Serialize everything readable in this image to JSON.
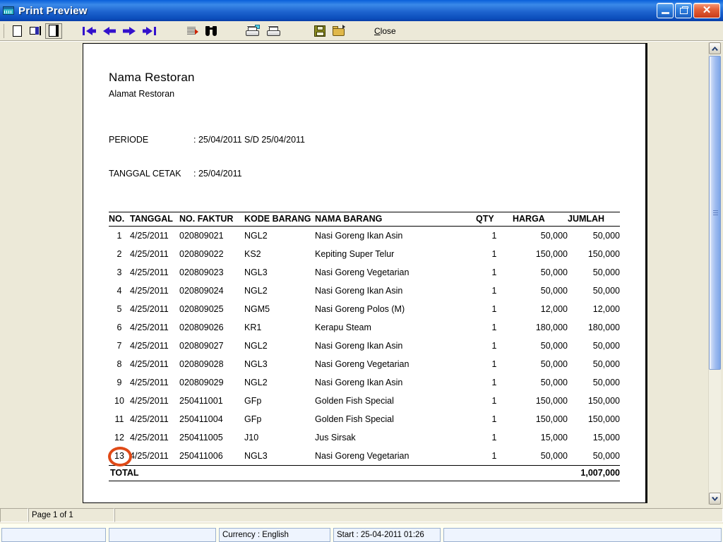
{
  "window": {
    "title": "Print Preview",
    "app_icon": "window-grid-icon",
    "controls": {
      "minimize": "minimize-button",
      "maximize": "maximize-restore-button",
      "close": "close-button",
      "close_glyph": "✕"
    }
  },
  "toolbar": {
    "buttons": [
      {
        "name": "single-page-view",
        "icon": "single-page-icon"
      },
      {
        "name": "two-page-view",
        "icon": "two-page-icon"
      },
      {
        "name": "page-width-view",
        "icon": "page-width-icon",
        "pressed": true
      },
      {
        "name": "first-page",
        "icon": "first-page-arrow-icon"
      },
      {
        "name": "previous-page",
        "icon": "previous-page-arrow-icon"
      },
      {
        "name": "next-page",
        "icon": "next-page-arrow-icon"
      },
      {
        "name": "last-page",
        "icon": "last-page-arrow-icon"
      },
      {
        "name": "goto-page",
        "icon": "lines-with-arrow-icon"
      },
      {
        "name": "find",
        "icon": "binoculars-icon"
      },
      {
        "name": "print-setup",
        "icon": "printer-setup-icon"
      },
      {
        "name": "print",
        "icon": "printer-icon"
      },
      {
        "name": "save",
        "icon": "floppy-disk-icon"
      },
      {
        "name": "open",
        "icon": "open-folder-icon"
      }
    ],
    "close_label_accel": "C",
    "close_label_rest": "lose",
    "close_label": "Close"
  },
  "document": {
    "title": "Nama Restoran",
    "subtitle": "Alamat Restoran",
    "meta": [
      {
        "label": "PERIODE",
        "value": ": 25/04/2011 S/D 25/04/2011"
      },
      {
        "label": "TANGGAL CETAK",
        "value": ": 25/04/2011"
      }
    ],
    "table": {
      "headers": [
        "NO.",
        "TANGGAL",
        "NO. FAKTUR",
        "KODE BARANG",
        "NAMA BARANG",
        "QTY",
        "HARGA",
        "JUMLAH"
      ],
      "rows": [
        [
          "1",
          "4/25/2011",
          "020809021",
          "NGL2",
          "Nasi Goreng Ikan Asin",
          "1",
          "50,000",
          "50,000"
        ],
        [
          "2",
          "4/25/2011",
          "020809022",
          "KS2",
          "Kepiting Super Telur",
          "1",
          "150,000",
          "150,000"
        ],
        [
          "3",
          "4/25/2011",
          "020809023",
          "NGL3",
          "Nasi Goreng Vegetarian",
          "1",
          "50,000",
          "50,000"
        ],
        [
          "4",
          "4/25/2011",
          "020809024",
          "NGL2",
          "Nasi Goreng Ikan Asin",
          "1",
          "50,000",
          "50,000"
        ],
        [
          "5",
          "4/25/2011",
          "020809025",
          "NGM5",
          "Nasi Goreng Polos (M)",
          "1",
          "12,000",
          "12,000"
        ],
        [
          "6",
          "4/25/2011",
          "020809026",
          "KR1",
          "Kerapu Steam",
          "1",
          "180,000",
          "180,000"
        ],
        [
          "7",
          "4/25/2011",
          "020809027",
          "NGL2",
          "Nasi Goreng Ikan Asin",
          "1",
          "50,000",
          "50,000"
        ],
        [
          "8",
          "4/25/2011",
          "020809028",
          "NGL3",
          "Nasi Goreng Vegetarian",
          "1",
          "50,000",
          "50,000"
        ],
        [
          "9",
          "4/25/2011",
          "020809029",
          "NGL2",
          "Nasi Goreng Ikan Asin",
          "1",
          "50,000",
          "50,000"
        ],
        [
          "10",
          "4/25/2011",
          "250411001",
          "GFp",
          "Golden Fish Special",
          "1",
          "150,000",
          "150,000"
        ],
        [
          "11",
          "4/25/2011",
          "250411004",
          "GFp",
          "Golden Fish Special",
          "1",
          "150,000",
          "150,000"
        ],
        [
          "12",
          "4/25/2011",
          "250411005",
          "J10",
          "Jus Sirsak",
          "1",
          "15,000",
          "15,000"
        ],
        [
          "13",
          "4/25/2011",
          "250411006",
          "NGL3",
          "Nasi Goreng Vegetarian",
          "1",
          "50,000",
          "50,000"
        ]
      ],
      "total_label": "TOTAL",
      "total_value": "1,007,000"
    },
    "annotation": {
      "name": "highlight-circle-row-13",
      "color": "#e04a17",
      "target": "13"
    }
  },
  "statusbar": {
    "page_indicator": "Page 1 of 1",
    "cell1": "",
    "cell3": ""
  },
  "statusbar2": {
    "cell1": "",
    "cell2": "",
    "currency": "Currency : English",
    "start": "Start  : 25-04-2011 01:26",
    "cell5": ""
  },
  "scrollbar": {
    "up_glyph": "▲",
    "down_glyph": "▼"
  }
}
